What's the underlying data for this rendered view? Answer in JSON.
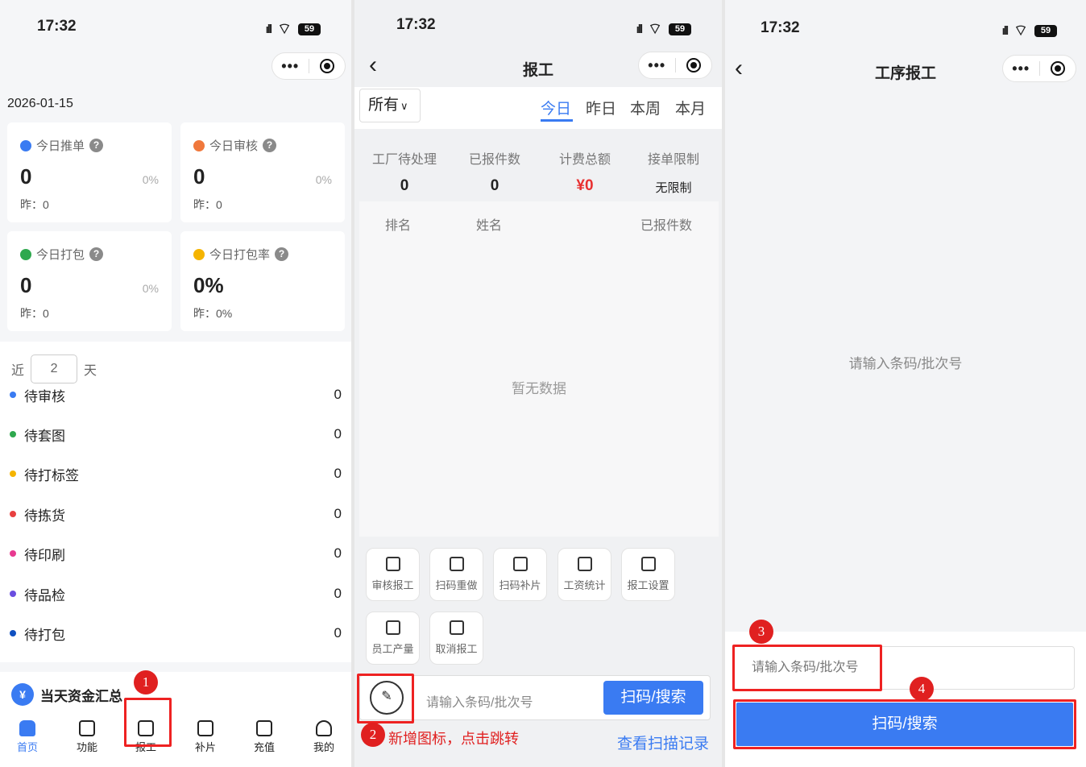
{
  "status": {
    "time": "17:32",
    "battery": "59"
  },
  "p1": {
    "date": "2026-01-15",
    "cards": [
      {
        "title": "今日推单",
        "value": "0",
        "pct": "0%",
        "yest": "昨：0",
        "color": "#3a7bf2"
      },
      {
        "title": "今日审核",
        "value": "0",
        "pct": "0%",
        "yest": "昨：0",
        "color": "#f0783c"
      },
      {
        "title": "今日打包",
        "value": "0",
        "pct": "0%",
        "yest": "昨：0",
        "color": "#2ea84e"
      },
      {
        "title": "今日打包率",
        "value": "0%",
        "pct": "",
        "yest": "昨：0%",
        "color": "#f5b400"
      }
    ],
    "near": {
      "prefix": "近",
      "days": "2",
      "suffix": "天"
    },
    "list": [
      {
        "label": "待审核",
        "value": "0",
        "color": "#3a7bf2"
      },
      {
        "label": "待套图",
        "value": "0",
        "color": "#2ea84e"
      },
      {
        "label": "待打标签",
        "value": "0",
        "color": "#f5b400"
      },
      {
        "label": "待拣货",
        "value": "0",
        "color": "#e84040"
      },
      {
        "label": "待印刷",
        "value": "0",
        "color": "#e83a90"
      },
      {
        "label": "待品检",
        "value": "0",
        "color": "#6a4ee0"
      },
      {
        "label": "待打包",
        "value": "0",
        "color": "#1050c0"
      }
    ],
    "peek": "当天资金汇总",
    "tabs": [
      "首页",
      "功能",
      "报工",
      "补片",
      "充值",
      "我的"
    ]
  },
  "p2": {
    "title": "报工",
    "select": "所有",
    "tabs": [
      "今日",
      "昨日",
      "本周",
      "本月"
    ],
    "stats": [
      {
        "label": "工厂待处理",
        "value": "0"
      },
      {
        "label": "已报件数",
        "value": "0"
      },
      {
        "label": "计费总额",
        "value": "¥0"
      },
      {
        "label": "接单限制",
        "value": "无限制"
      }
    ],
    "rank_headers": [
      "排名",
      "姓名",
      "已报件数"
    ],
    "empty": "暂无数据",
    "tools": [
      "审核报工",
      "扫码重做",
      "扫码补片",
      "工资统计",
      "报工设置",
      "员工产量",
      "取消报工"
    ],
    "placeholder": "请输入条码/批次号",
    "scan_btn": "扫码/搜索",
    "record_link": "查看扫描记录",
    "annotation": "新增图标，点击跳转"
  },
  "p3": {
    "title": "工序报工",
    "hint": "请输入条码/批次号",
    "placeholder": "请输入条码/批次号",
    "btn": "扫码/搜索"
  },
  "badges": [
    "1",
    "2",
    "3",
    "4"
  ]
}
